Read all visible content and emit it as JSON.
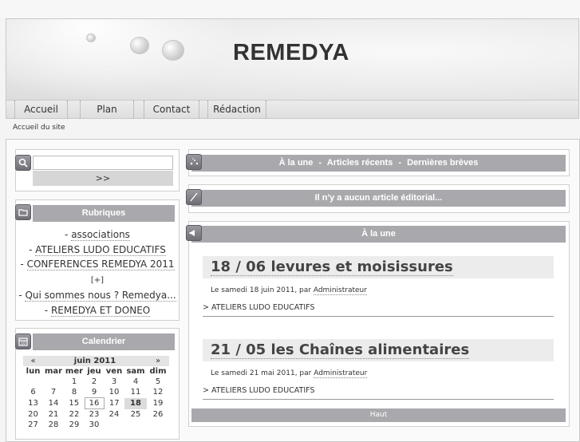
{
  "site": {
    "title": "REMEDYA"
  },
  "nav": {
    "items": [
      "Accueil",
      "Plan",
      "Contact",
      "Rédaction"
    ]
  },
  "breadcrumb": "Accueil du site",
  "search": {
    "value": "",
    "button_label": ">>"
  },
  "rubriques": {
    "title": "Rubriques",
    "items": [
      {
        "label": "associations"
      },
      {
        "label": "ATELIERS LUDO EDUCATIFS"
      },
      {
        "label": "CONFERENCES REMEDYA 2011",
        "extra": "[+]"
      },
      {
        "label": "Qui sommes nous ? Remedya..."
      },
      {
        "label": "REMEDYA ET DONEO"
      }
    ]
  },
  "calendar": {
    "title": "Calendrier",
    "prev": "«",
    "month": "juin 2011",
    "next": "»",
    "weekdays": [
      "lun",
      "mar",
      "mer",
      "jeu",
      "ven",
      "sam",
      "dim"
    ],
    "weeks": [
      [
        "",
        "",
        "1",
        "2",
        "3",
        "4",
        "5"
      ],
      [
        "6",
        "7",
        "8",
        "9",
        "10",
        "11",
        "12"
      ],
      [
        "13",
        "14",
        "15",
        "16",
        "17",
        "18",
        "19"
      ],
      [
        "20",
        "21",
        "22",
        "23",
        "24",
        "25",
        "26"
      ],
      [
        "27",
        "28",
        "29",
        "30",
        "",
        "",
        ""
      ]
    ],
    "today": "16",
    "highlight": "18"
  },
  "top_tabs": {
    "items": [
      "À la une",
      "Articles récents",
      "Dernières brèves"
    ],
    "separator": "-"
  },
  "editorial": {
    "text": "Il n'y a aucun article éditorial..."
  },
  "une": {
    "title": "À la une",
    "articles": [
      {
        "title": "18 / 06 levures et moisissures",
        "date_prefix": "Le samedi 18 juin 2011, par ",
        "author": "Administrateur",
        "category": "> ATELIERS LUDO EDUCATIFS"
      },
      {
        "title": "21 / 05 les Chaînes alimentaires",
        "date_prefix": "Le samedi 21 mai 2011, par ",
        "author": "Administrateur",
        "category": "> ATELIERS LUDO EDUCATIFS"
      }
    ],
    "back_to_top": "Haut"
  },
  "colors": {
    "bar": "#a9a9ad",
    "background": "#f4f4f4",
    "text": "#333333"
  },
  "icons": [
    "search-icon",
    "folder-icon",
    "calendar-icon",
    "sparkle-icon",
    "pen-icon",
    "megaphone-icon"
  ]
}
